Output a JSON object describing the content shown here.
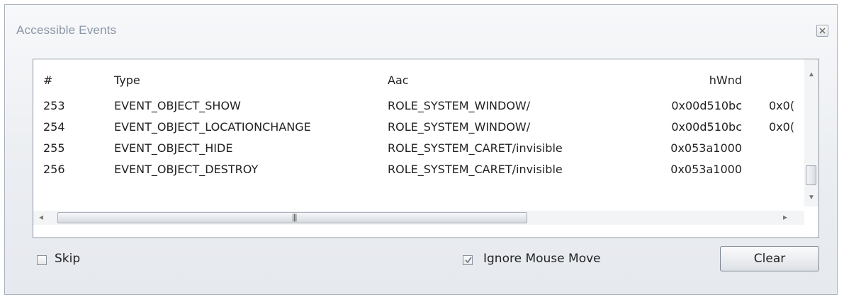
{
  "window": {
    "title": "Accessible Events"
  },
  "list": {
    "columns": {
      "num": "#",
      "type": "Type",
      "aac": "Aac",
      "hwnd": "hWnd"
    },
    "rows": [
      {
        "num": "253",
        "type": "EVENT_OBJECT_SHOW",
        "aac": "ROLE_SYSTEM_WINDOW/",
        "hwnd": "0x00d510bc",
        "extra": "0x0("
      },
      {
        "num": "254",
        "type": "EVENT_OBJECT_LOCATIONCHANGE",
        "aac": "ROLE_SYSTEM_WINDOW/",
        "hwnd": "0x00d510bc",
        "extra": "0x0("
      },
      {
        "num": "255",
        "type": "EVENT_OBJECT_HIDE",
        "aac": "ROLE_SYSTEM_CARET/invisible",
        "hwnd": "0x053a1000",
        "extra": ""
      },
      {
        "num": "256",
        "type": "EVENT_OBJECT_DESTROY",
        "aac": "ROLE_SYSTEM_CARET/invisible",
        "hwnd": "0x053a1000",
        "extra": ""
      }
    ]
  },
  "controls": {
    "skip_label": "Skip",
    "skip_checked": false,
    "ignore_mouse_label": "Ignore Mouse Move",
    "ignore_mouse_checked": true,
    "clear_label": "Clear"
  },
  "icons": {
    "close": "close-icon",
    "scroll_up": "chevron-up-icon",
    "scroll_down": "chevron-down-icon",
    "scroll_left": "chevron-left-icon",
    "scroll_right": "chevron-right-icon"
  }
}
